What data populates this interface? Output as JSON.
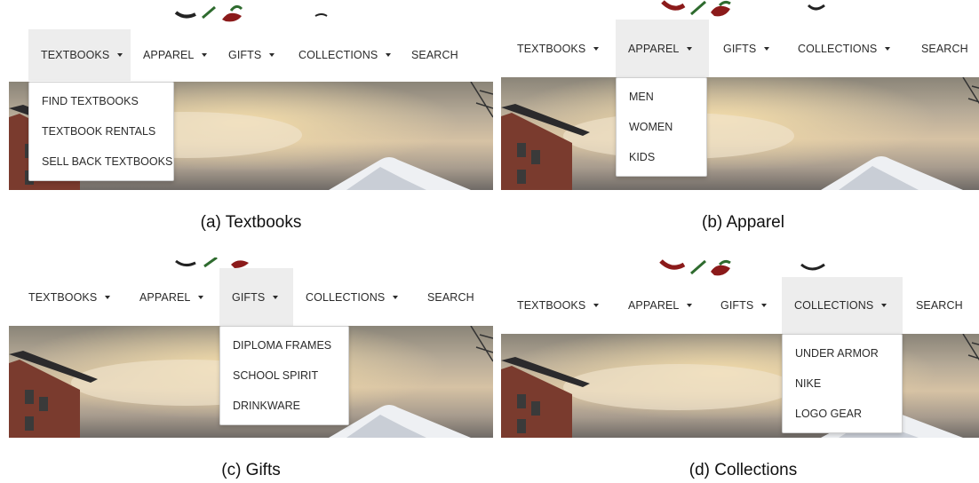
{
  "colors": {
    "active_tab_bg": "#ededed",
    "text": "#2b2b2b",
    "logo_red": "#8b1a1a",
    "logo_green": "#2e6b2e"
  },
  "panels": {
    "a": {
      "nav": [
        "TEXTBOOKS",
        "APPAREL",
        "GIFTS",
        "COLLECTIONS",
        "SEARCH"
      ],
      "active": "TEXTBOOKS",
      "dropdown": [
        "FIND TEXTBOOKS",
        "TEXTBOOK RENTALS",
        "SELL BACK TEXTBOOKS"
      ],
      "caption": "(a)  Textbooks"
    },
    "b": {
      "nav": [
        "TEXTBOOKS",
        "APPAREL",
        "GIFTS",
        "COLLECTIONS",
        "SEARCH"
      ],
      "active": "APPAREL",
      "dropdown": [
        "MEN",
        "WOMEN",
        "KIDS"
      ],
      "caption": "(b)  Apparel"
    },
    "c": {
      "nav": [
        "TEXTBOOKS",
        "APPAREL",
        "GIFTS",
        "COLLECTIONS",
        "SEARCH"
      ],
      "active": "GIFTS",
      "dropdown": [
        "DIPLOMA FRAMES",
        "SCHOOL SPIRIT",
        "DRINKWARE"
      ],
      "caption": "(c)  Gifts"
    },
    "d": {
      "nav": [
        "TEXTBOOKS",
        "APPAREL",
        "GIFTS",
        "COLLECTIONS",
        "SEARCH"
      ],
      "active": "COLLECTIONS",
      "dropdown": [
        "UNDER ARMOR",
        "NIKE",
        "LOGO GEAR"
      ],
      "caption": "(d)  Collections"
    }
  }
}
